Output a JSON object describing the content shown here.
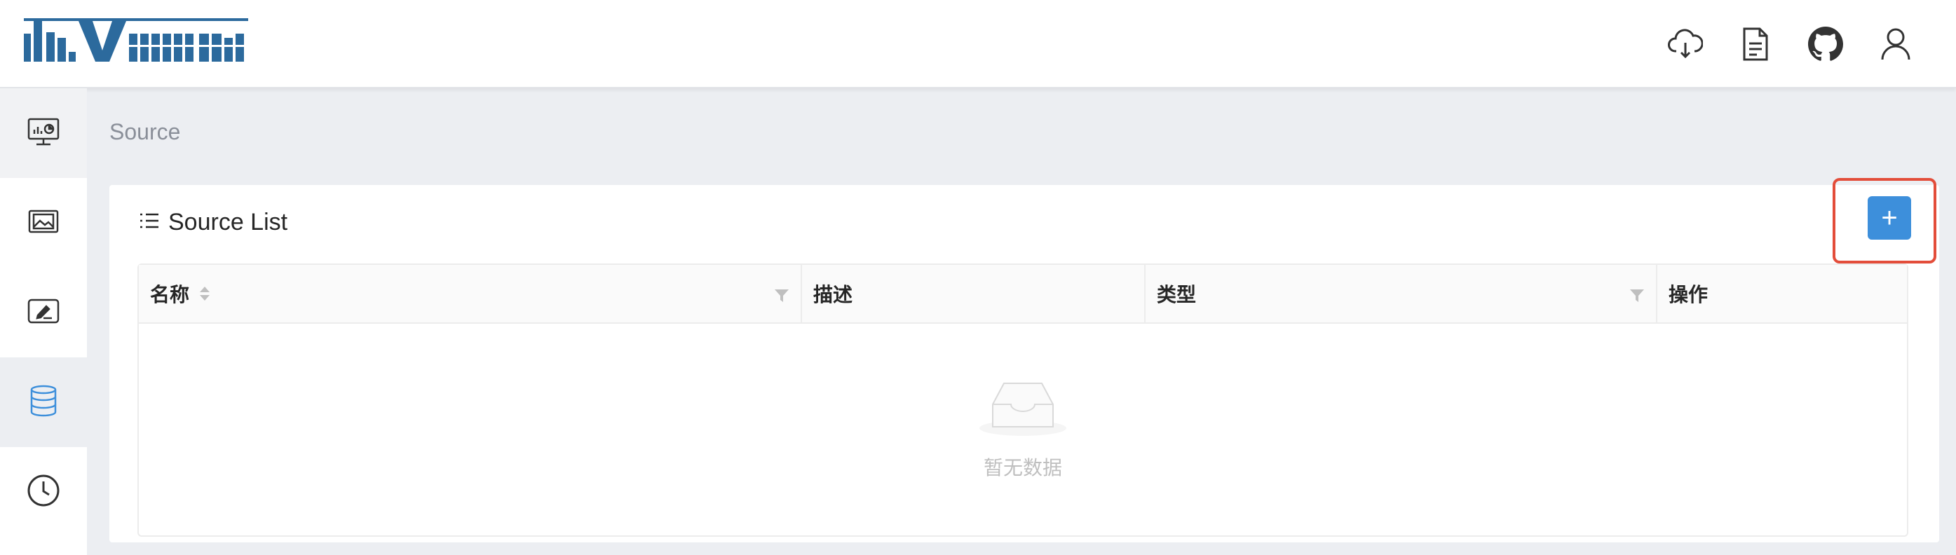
{
  "header": {
    "logo_text": "davinci",
    "icons": [
      "cloud-download-icon",
      "document-icon",
      "github-icon",
      "user-icon"
    ]
  },
  "sidebar": {
    "items": [
      {
        "name": "dashboard",
        "icon": "monitor-chart-icon"
      },
      {
        "name": "widgets",
        "icon": "image-frame-icon"
      },
      {
        "name": "views",
        "icon": "edit-screen-icon"
      },
      {
        "name": "sources",
        "icon": "database-icon",
        "active": true
      },
      {
        "name": "schedules",
        "icon": "clock-icon"
      }
    ]
  },
  "page": {
    "title": "Source"
  },
  "card": {
    "title": "Source List",
    "add_label": "+"
  },
  "table": {
    "columns": [
      "名称",
      "描述",
      "类型",
      "操作"
    ],
    "empty_text": "暂无数据"
  },
  "colors": {
    "accent": "#3d8fdb",
    "highlight_border": "#e34d3a",
    "logo": "#2c6a9d"
  }
}
